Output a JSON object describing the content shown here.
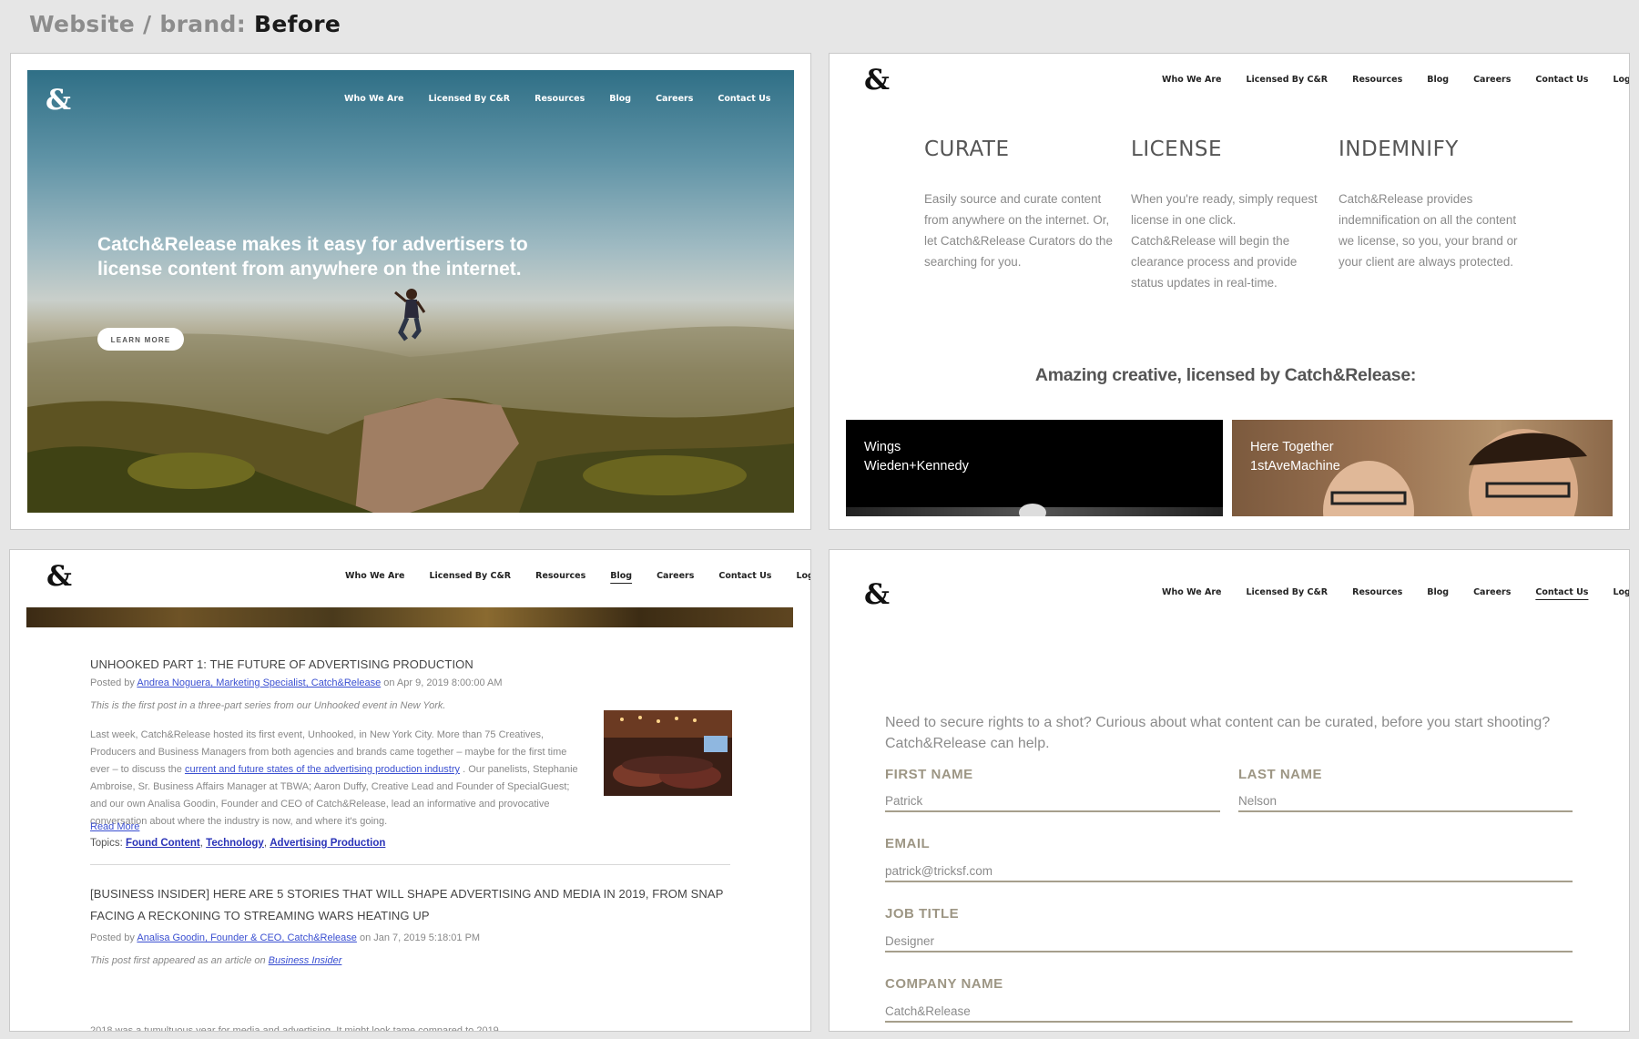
{
  "heading": {
    "prefix": "Website / brand:",
    "emphasis": "Before"
  },
  "logo": "&",
  "nav": [
    "Who We Are",
    "Licensed By C&R",
    "Resources",
    "Blog",
    "Careers",
    "Contact Us",
    "Log In"
  ],
  "hero": {
    "headline": "Catch&Release makes it easy for advertisers to license content from anywhere on the internet.",
    "cta": "LEARN MORE"
  },
  "features": [
    {
      "title": "CURATE",
      "text": "Easily source and curate content from anywhere on the internet. Or, let Catch&Release Curators do the searching for you."
    },
    {
      "title": "LICENSE",
      "text": "When you're ready, simply request license in one click. Catch&Release will begin the clearance process and provide status updates in real-time."
    },
    {
      "title": "INDEMNIFY",
      "text": "Catch&Release provides indemnification on all the content we license, so you, your brand or your client are always protected."
    }
  ],
  "amazing": "Amazing creative, licensed by Catch&Release:",
  "tiles": [
    {
      "title": "Wings",
      "agency": "Wieden+Kennedy"
    },
    {
      "title": "Here Together",
      "agency": "1stAveMachine"
    }
  ],
  "blog": {
    "post1": {
      "title": "UNHOOKED PART 1: THE FUTURE OF ADVERTISING PRODUCTION",
      "posted_by": "Posted by",
      "author": "Andrea Noguera, Marketing Specialist, Catch&Release",
      "date": "on Apr 9, 2019 8:00:00 AM",
      "intro": "This is the first post in a three-part series from our Unhooked event in New York.",
      "body_a": "Last week, Catch&Release hosted its first event, Unhooked, in New York City. More than 75 Creatives, Producers and Business Managers from both agencies and brands came together – maybe for the first time ever – to discuss the",
      "body_link": "current and future states of the advertising production industry",
      "body_b": ". Our panelists, Stephanie Ambroise, Sr. Business Affairs Manager at TBWA; Aaron Duffy, Creative Lead and Founder of SpecialGuest; and our own Analisa Goodin, Founder and CEO of Catch&Release, lead an informative and provocative conversation about where the industry is now, and where it's going.",
      "read_more": "Read More",
      "topics_label": "Topics:",
      "topics": [
        "Found Content",
        "Technology",
        "Advertising Production"
      ]
    },
    "post2": {
      "title_line1": "[BUSINESS INSIDER] HERE ARE 5 STORIES THAT WILL SHAPE ADVERTISING AND MEDIA IN 2019, FROM SNAP",
      "title_line2": "FACING A RECKONING TO STREAMING WARS HEATING UP",
      "posted_by": "Posted by",
      "author": "Analisa Goodin, Founder & CEO, Catch&Release",
      "date": "on Jan 7, 2019 5:18:01 PM",
      "intro_text": "This post first appeared as an article on",
      "intro_link": "Business Insider",
      "body": "2018 was a tumultuous year for media and advertising. It might look tame compared to 2019."
    }
  },
  "contact": {
    "intro": "Need to secure rights to a shot? Curious about what content can be curated, before you start shooting? Catch&Release can help.",
    "fields": [
      {
        "label": "FIRST NAME",
        "value": "Patrick"
      },
      {
        "label": "LAST NAME",
        "value": "Nelson"
      },
      {
        "label": "EMAIL",
        "value": "patrick@tricksf.com"
      },
      {
        "label": "JOB TITLE",
        "value": "Designer"
      },
      {
        "label": "COMPANY NAME",
        "value": "Catch&Release"
      }
    ]
  },
  "colors": {
    "link": "#3a4fd1",
    "form_label": "#9d9684",
    "form_line": "#a69f8c",
    "text_gray": "#8a8a8a"
  }
}
